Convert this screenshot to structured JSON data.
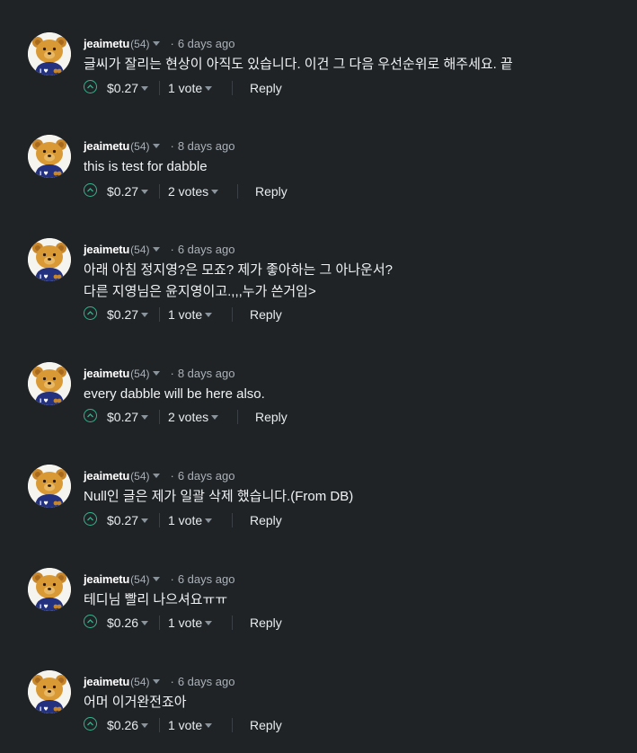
{
  "comments": [
    {
      "author": "jeaimetu",
      "reputation": "(54)",
      "time": "6 days ago",
      "body": "글씨가 잘리는 현상이 아직도 있습니다. 이건 그 다음 우선순위로 해주세요. 끝",
      "payout": "$0.27",
      "votes": "1 vote",
      "reply": "Reply"
    },
    {
      "author": "jeaimetu",
      "reputation": "(54)",
      "time": "8 days ago",
      "body": "this is test for dabble",
      "payout": "$0.27",
      "votes": "2 votes",
      "reply": "Reply"
    },
    {
      "author": "jeaimetu",
      "reputation": "(54)",
      "time": "6 days ago",
      "body": "아래 아침 정지영?은 모죠? 제가 좋아하는 그 아나운서?\n다른 지영님은 윤지영이고.,,,누가 쓴거임>",
      "payout": "$0.27",
      "votes": "1 vote",
      "reply": "Reply"
    },
    {
      "author": "jeaimetu",
      "reputation": "(54)",
      "time": "8 days ago",
      "body": "every dabble will be here also.",
      "payout": "$0.27",
      "votes": "2 votes",
      "reply": "Reply"
    },
    {
      "author": "jeaimetu",
      "reputation": "(54)",
      "time": "6 days ago",
      "body": "Null인 글은 제가 일괄 삭제 했습니다.(From DB)",
      "payout": "$0.27",
      "votes": "1 vote",
      "reply": "Reply"
    },
    {
      "author": "jeaimetu",
      "reputation": "(54)",
      "time": "6 days ago",
      "body": "테디님 빨리 나으셔요ㅠㅠ",
      "payout": "$0.26",
      "votes": "1 vote",
      "reply": "Reply"
    },
    {
      "author": "jeaimetu",
      "reputation": "(54)",
      "time": "6 days ago",
      "body": "어머 이거완전죠아",
      "payout": "$0.26",
      "votes": "1 vote",
      "reply": "Reply"
    }
  ],
  "colors": {
    "background": "#1f2326",
    "upvote_accent": "#34b28c",
    "muted_text": "#a9b1b8"
  },
  "avatar_badge": "I ♥",
  "icons": {
    "upvote": "chevron-up-circle-icon",
    "dropdown": "caret-down-icon",
    "separator": "dot-separator"
  }
}
